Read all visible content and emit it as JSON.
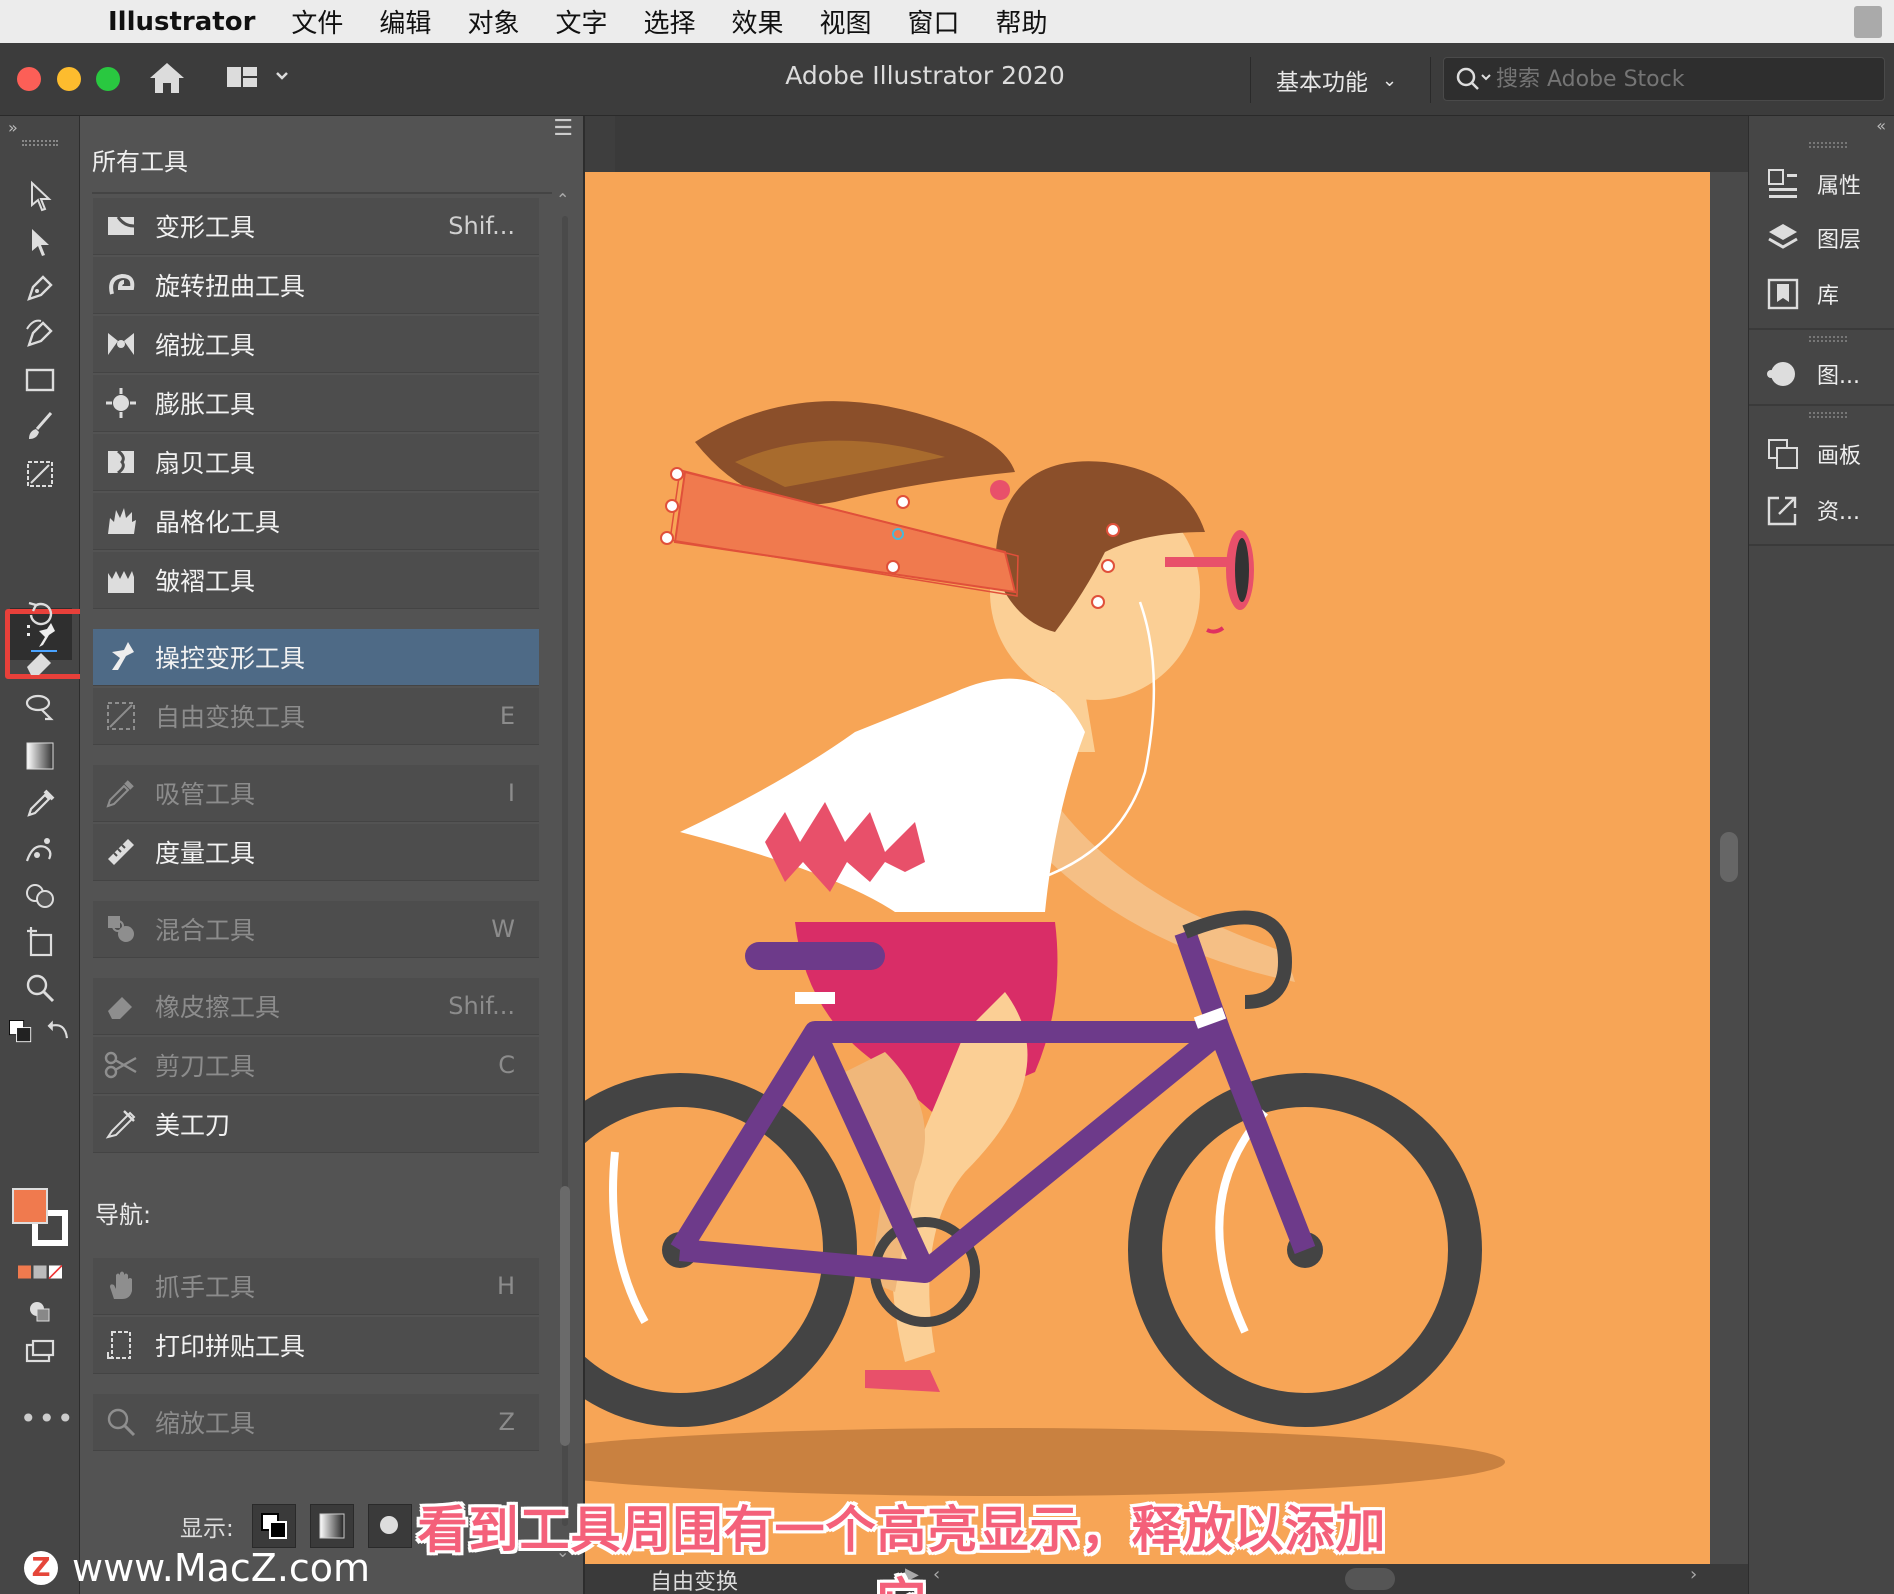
{
  "menubar": {
    "app_name": "Illustrator",
    "items": [
      "文件",
      "编辑",
      "对象",
      "文字",
      "选择",
      "效果",
      "视图",
      "窗口",
      "帮助"
    ]
  },
  "titlebar": {
    "title": "Adobe Illustrator 2020",
    "workspace": "基本功能",
    "search_placeholder": "搜索 Adobe Stock"
  },
  "tools_panel": {
    "title": "所有工具",
    "items": [
      {
        "label": "变形工具",
        "shortcut": "Shif...",
        "icon": "warp-icon",
        "state": "normal"
      },
      {
        "label": "旋转扭曲工具",
        "shortcut": "",
        "icon": "twirl-icon",
        "state": "normal"
      },
      {
        "label": "缩拢工具",
        "shortcut": "",
        "icon": "pucker-icon",
        "state": "normal"
      },
      {
        "label": "膨胀工具",
        "shortcut": "",
        "icon": "bloat-icon",
        "state": "normal"
      },
      {
        "label": "扇贝工具",
        "shortcut": "",
        "icon": "scallop-icon",
        "state": "normal"
      },
      {
        "label": "晶格化工具",
        "shortcut": "",
        "icon": "crystallize-icon",
        "state": "normal"
      },
      {
        "label": "皱褶工具",
        "shortcut": "",
        "icon": "wrinkle-icon",
        "state": "normal"
      },
      {
        "label": "操控变形工具",
        "shortcut": "",
        "icon": "puppet-warp-icon",
        "state": "selected"
      },
      {
        "label": "自由变换工具",
        "shortcut": "E",
        "icon": "free-transform-icon",
        "state": "dim"
      },
      {
        "label": "吸管工具",
        "shortcut": "I",
        "icon": "eyedropper-icon",
        "state": "dim"
      },
      {
        "label": "度量工具",
        "shortcut": "",
        "icon": "measure-icon",
        "state": "normal"
      },
      {
        "label": "混合工具",
        "shortcut": "W",
        "icon": "blend-icon",
        "state": "dim"
      },
      {
        "label": "橡皮擦工具",
        "shortcut": "Shif...",
        "icon": "eraser-icon",
        "state": "dim"
      },
      {
        "label": "剪刀工具",
        "shortcut": "C",
        "icon": "scissors-icon",
        "state": "dim"
      },
      {
        "label": "美工刀",
        "shortcut": "",
        "icon": "knife-icon",
        "state": "normal"
      }
    ],
    "nav_section": "导航:",
    "nav_items": [
      {
        "label": "抓手工具",
        "shortcut": "H",
        "icon": "hand-icon",
        "state": "dim"
      },
      {
        "label": "打印拼贴工具",
        "shortcut": "",
        "icon": "print-tiling-icon",
        "state": "normal"
      },
      {
        "label": "缩放工具",
        "shortcut": "Z",
        "icon": "zoom-icon",
        "state": "dim"
      }
    ],
    "display_label": "显示:"
  },
  "right_dock": {
    "items": [
      {
        "label": "属性",
        "icon": "properties-icon"
      },
      {
        "label": "图层",
        "icon": "layers-icon"
      },
      {
        "label": "库",
        "icon": "libraries-icon"
      },
      {
        "label": "图...",
        "icon": "graphic-styles-icon"
      },
      {
        "label": "画板",
        "icon": "artboards-icon"
      },
      {
        "label": "资...",
        "icon": "asset-export-icon"
      }
    ]
  },
  "statusbar": {
    "tool": "自由变换"
  },
  "subtitle": "看到工具周围有一个高亮显示，释放以添加它",
  "watermark": "www.MacZ.com",
  "colors": {
    "artboard": "#f7a556",
    "selected_row": "#4e6a86",
    "highlight_box": "#e8403a",
    "fill_swatch": "#f07a4e"
  }
}
